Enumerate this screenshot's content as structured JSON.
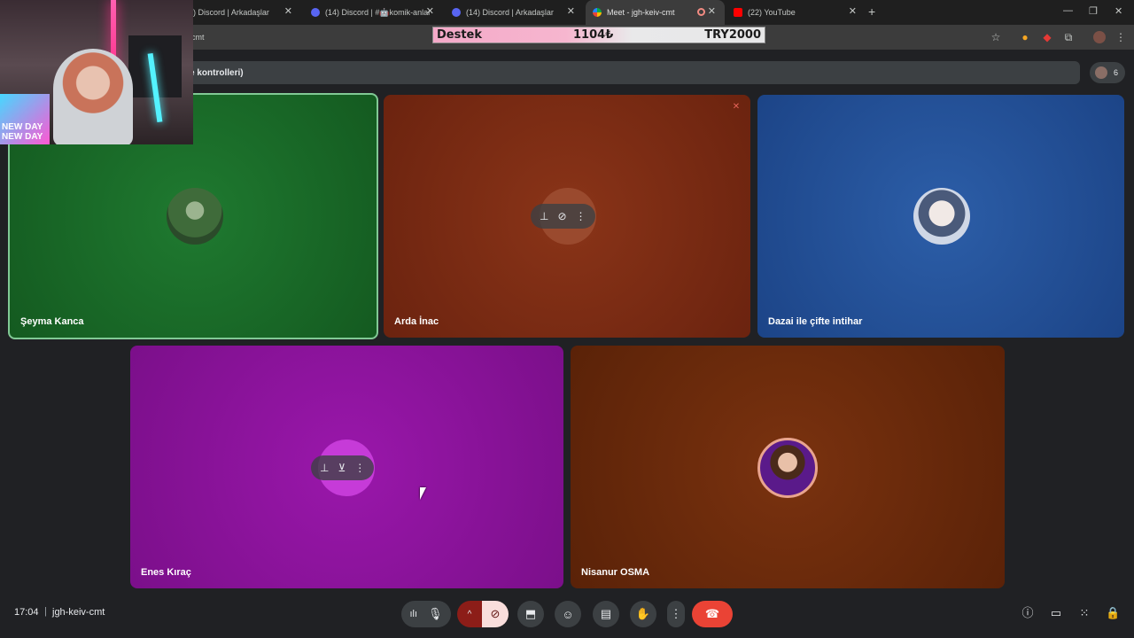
{
  "browser": {
    "tabs": [
      {
        "label": ") Discord | Arkadaşlar",
        "icon": "discord-icon"
      },
      {
        "label": "(14) Discord | #🤖komik-anlar",
        "icon": "discord-icon"
      },
      {
        "label": "(14) Discord | Arkadaşlar",
        "icon": "discord-icon"
      },
      {
        "label": "Meet - jgh-keiv-cmt",
        "icon": "meet-icon",
        "active": true
      },
      {
        "label": "(22) YouTube",
        "icon": "youtube-icon"
      }
    ],
    "new_tab": "+",
    "minimize": "—",
    "restore": "❐",
    "close": "✕",
    "tab_close": "✕",
    "address_fragment": "cmt"
  },
  "donation_bar": {
    "label": "Destek",
    "current": "1104₺",
    "goal": "TRY2000"
  },
  "meet": {
    "banner_text": "e kontrolleri)",
    "participant_count": "6",
    "participants": [
      {
        "name": "Şeyma Kanca",
        "color": "#1e6b2a",
        "speaking": true
      },
      {
        "name": "Arda İnac",
        "color": "#7a2a14",
        "muted": true
      },
      {
        "name": "Dazai ile çifte intihar",
        "color": "#1e4f9a"
      },
      {
        "name": "Enes Kıraç",
        "color": "#8a149a"
      },
      {
        "name": "Nisanur OSMA",
        "color": "#6b2a0c"
      }
    ],
    "time": "17:04",
    "separator": "|",
    "meeting_code": "jgh-keiv-cmt"
  },
  "webcam_overlay": {
    "badge_text_1": "NEW DAY",
    "badge_text_2": "NEW DAY"
  },
  "colors": {
    "meet_bg": "#202124",
    "leave_red": "#ea4335",
    "speaking_border": "#81c995"
  }
}
